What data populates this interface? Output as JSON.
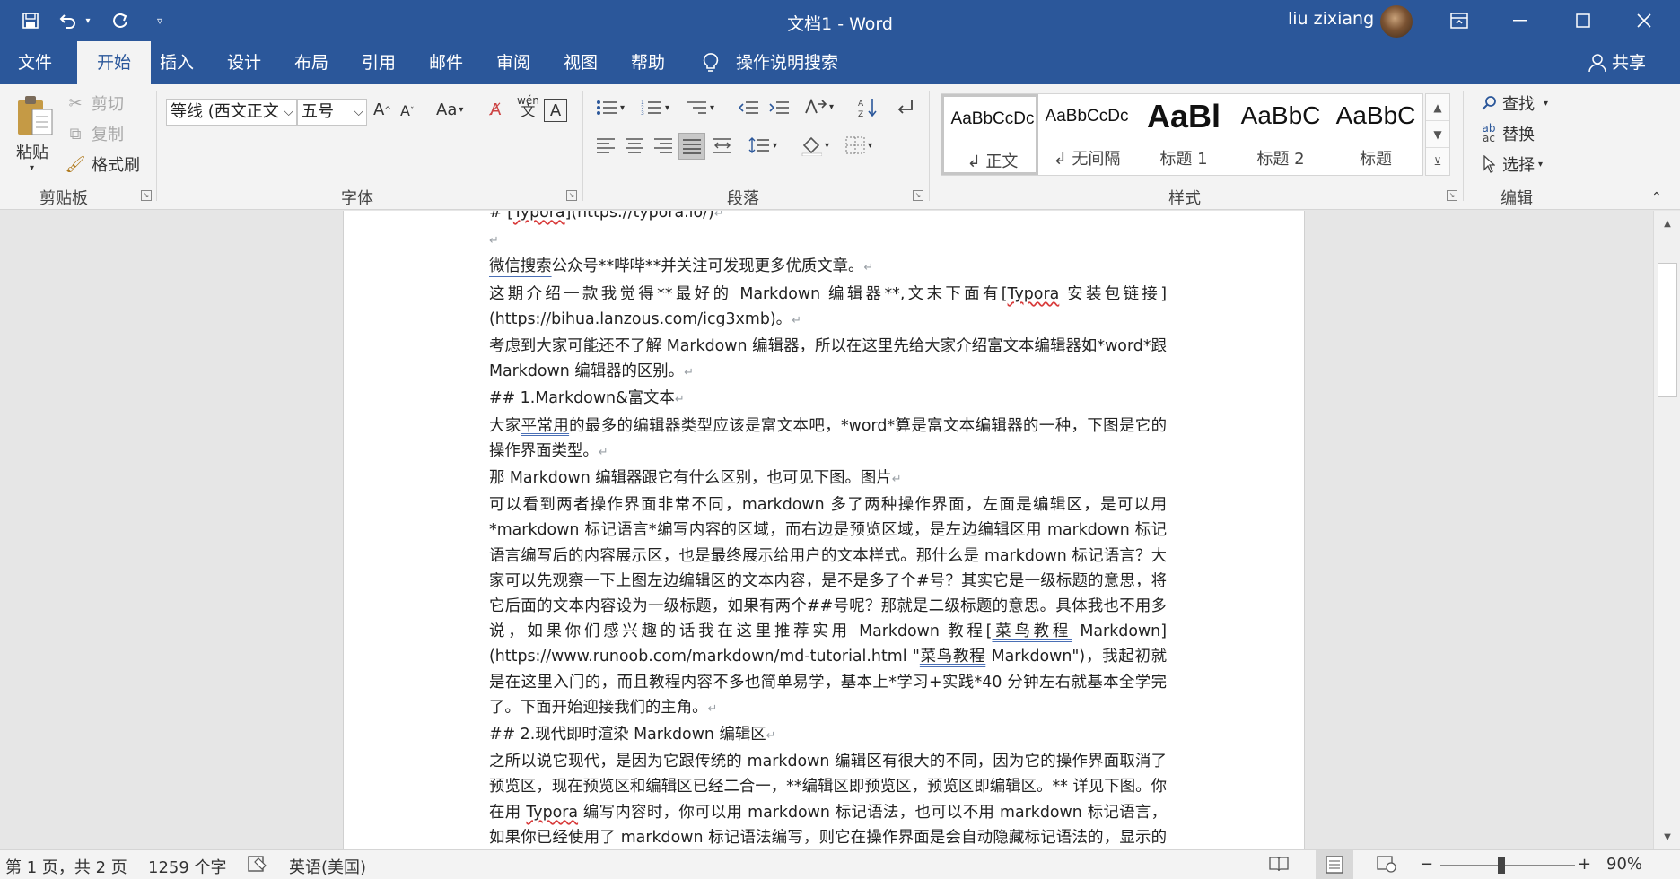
{
  "title_bar": {
    "doc_title": "文档1  -  Word",
    "user_name": "liu zixiang",
    "qat": {
      "save_icon": "save-icon",
      "undo_icon": "undo-icon",
      "redo_icon": "redo-icon",
      "customize_icon": "customize-qat-icon"
    },
    "window_buttons": [
      "ribbon-display-options",
      "minimize",
      "maximize",
      "close"
    ]
  },
  "ribbon_tabs": [
    "文件",
    "开始",
    "插入",
    "设计",
    "布局",
    "引用",
    "邮件",
    "审阅",
    "视图",
    "帮助"
  ],
  "active_tab": "开始",
  "tell_me": "操作说明搜索",
  "share": "共享",
  "clipboard": {
    "label": "剪贴板",
    "paste": "粘贴",
    "cut": "剪切",
    "copy": "复制",
    "format_painter": "格式刷"
  },
  "font": {
    "label": "字体",
    "font_name": "等线 (西文正文",
    "font_size": "五号",
    "change_case": "Aa"
  },
  "paragraph": {
    "label": "段落"
  },
  "styles": {
    "label": "样式",
    "items": [
      {
        "preview": "AaBbCcDc",
        "name": "↲ 正文"
      },
      {
        "preview": "AaBbCcDc",
        "name": "↲ 无间隔"
      },
      {
        "preview": "AaBl",
        "name": "标题 1"
      },
      {
        "preview": "AaBbC",
        "name": "标题 2"
      },
      {
        "preview": "AaBbC",
        "name": "标题"
      }
    ]
  },
  "editing": {
    "label": "编辑",
    "find": "查找",
    "replace": "替换",
    "select": "选择"
  },
  "document": {
    "pilcrow": "↵",
    "lines": {
      "l0_a": "# [",
      "l0_b": "Typora",
      "l0_c": "](https://typora.io/)",
      "l2_a": "微信搜索",
      "l2_b": "公众号**哔哔**并关注可发现更多优质文章。",
      "l3_a": "这期介绍一款我觉得**最好的 Markdown 编辑器**,文末下面有[",
      "l3_b": "Typora",
      "l3_c": " 安装包链接](https://bihua.lanzous.com/icg3xmb)。",
      "l4": "考虑到大家可能还不了解 Markdown 编辑器，所以在这里先给大家介绍富文本编辑器如*word*跟 Markdown 编辑器的区别。",
      "l5": "## 1.Markdown&富文本",
      "l6_a": "大家",
      "l6_b": "平常用",
      "l6_c": "的最多的编辑器类型应该是富文本吧，*word*算是富文本编辑器的一种，下图是它的操作界面类型。",
      "l7": "那 Markdown 编辑器跟它有什么区别，也可见下图。图片",
      "l8_a": "可以看到两者操作界面非常不同，markdown 多了两种操作界面，左面是编辑区，是可以用*markdown 标记语言*编写内容的区域，而右边是预览区域，是左边编辑区用 markdown 标记语言编写后的内容展示区，也是最终展示给用户的文本样式。那什么是 markdown 标记语言？大家可以先观察一下上图左边编辑区的文本内容，是不是多了个#号？其实它是一级标题的意思，将它后面的文本内容设为一级标题，如果有两个##号呢？那就是二级标题的意思。具体我也不用多说，如果你们感兴趣的话我在这里推荐实用 Markdown 教程[",
      "l8_b": "菜鸟教程",
      "l8_c": " Markdown](https://www.runoob.com/markdown/md-tutorial.html \"",
      "l8_d": "菜鸟教程",
      "l8_e": " Markdown\")，我起初就是在这里入门的，而且教程内容不多也简单易学，基本上*学习+实践*40 分钟左右就基本全学完了。下面开始迎接我们的主角。",
      "l9": "## 2.现代即时渲染 Markdown 编辑区",
      "l10_a": "之所以说它现代，是因为它跟传统的 markdown 编辑区有很大的不同，因为它的操作界面取消了预览区，现在预览区和编辑区已经二合一，**编辑区即预览区，预览区即编辑区。** 详见下图。你在用 ",
      "l10_b": "Typora",
      "l10_c": " 编写内容时，你可以用 markdown 标记语法，也可以不用 markdown 标记语言，如果你已经使用了 markdown 标记语法编写，则它在操作界面是会自动隐藏标记语法的，显示的正是即时渲染后的文本内容，即预览区的内容。这是目前其他预览区没有的"
    }
  },
  "status_bar": {
    "page": "第 1 页，共 2 页",
    "words": "1259 个字",
    "language": "英语(美国)",
    "zoom": "90%",
    "zoom_fraction": 0.45
  },
  "colors": {
    "brand": "#2b579a",
    "ribbon_bg": "#f3f3f3",
    "canvas": "#e6e6e6"
  }
}
